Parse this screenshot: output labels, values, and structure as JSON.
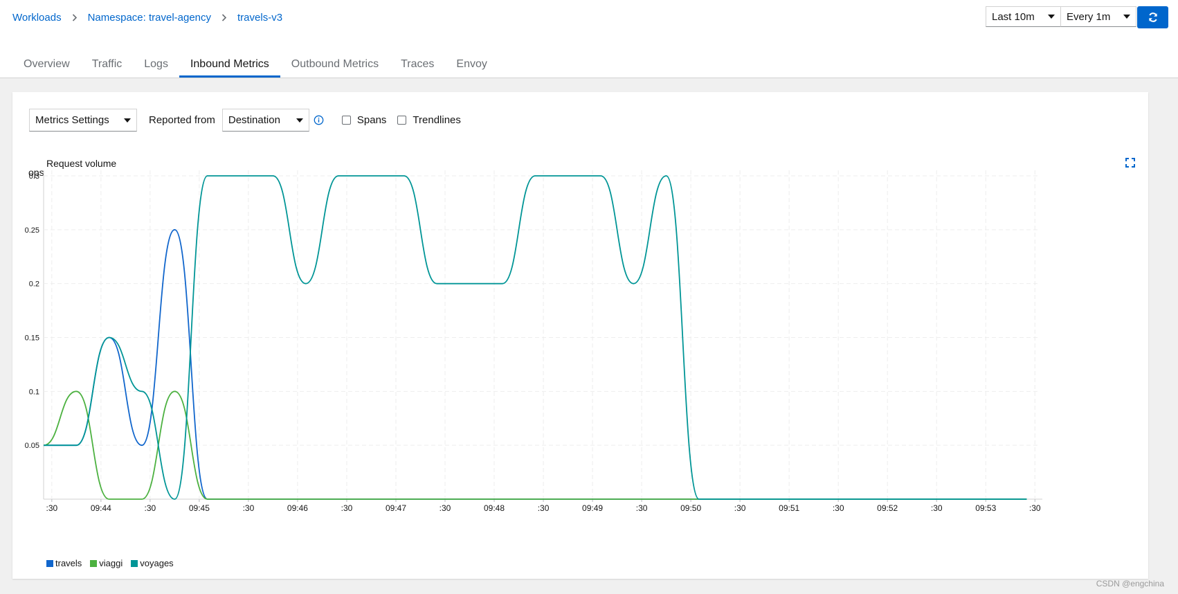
{
  "breadcrumb": {
    "items": [
      "Workloads",
      "Namespace: travel-agency",
      "travels-v3"
    ]
  },
  "controls": {
    "time_range": "Last 10m",
    "refresh_interval": "Every 1m",
    "refresh_icon": "sync-icon"
  },
  "tabs": [
    {
      "label": "Overview"
    },
    {
      "label": "Traffic"
    },
    {
      "label": "Logs"
    },
    {
      "label": "Inbound Metrics",
      "active": true
    },
    {
      "label": "Outbound Metrics"
    },
    {
      "label": "Traces"
    },
    {
      "label": "Envoy"
    }
  ],
  "toolbar": {
    "metrics_settings": "Metrics Settings",
    "reported_from_label": "Reported from",
    "reported_from_value": "Destination",
    "spans_label": "Spans",
    "trendlines_label": "Trendlines",
    "spans_checked": false,
    "trendlines_checked": false
  },
  "colors": {
    "accent": "#0066cc",
    "travels": "#1166cc",
    "viaggi": "#4cb140",
    "voyages": "#009596",
    "grid": "#ededed"
  },
  "chart_data": {
    "type": "line",
    "title": "Request volume",
    "ylabel": "ops",
    "ylim": [
      0,
      0.3
    ],
    "y_ticks": [
      0.05,
      0.1,
      0.15,
      0.2,
      0.25,
      0.3
    ],
    "y_tick_labels": [
      "0.05",
      "0.1",
      "0.15",
      "0.2",
      "0.25",
      "0.3"
    ],
    "x_tick_labels": [
      ":30",
      "09:44",
      ":30",
      "09:45",
      ":30",
      "09:46",
      ":30",
      "09:47",
      ":30",
      "09:48",
      ":30",
      "09:49",
      ":30",
      "09:50",
      ":30",
      "09:51",
      ":30",
      "09:52",
      ":30",
      "09:53",
      ":30"
    ],
    "x_ticks": [
      "09:43:30",
      "09:44:00",
      "09:44:30",
      "09:45:00",
      "09:45:30",
      "09:46:00",
      "09:46:30",
      "09:47:00",
      "09:47:30",
      "09:48:00",
      "09:48:30",
      "09:49:00",
      "09:49:30",
      "09:50:00",
      "09:50:30",
      "09:51:00",
      "09:51:30",
      "09:52:00",
      "09:52:30",
      "09:53:00",
      "09:53:30"
    ],
    "x_range": [
      "09:43:25",
      "09:53:32"
    ],
    "legend_position": "bottom-left",
    "grid": true,
    "series": [
      {
        "name": "travels",
        "x": [
          "09:43:25",
          "09:43:45",
          "09:44:05",
          "09:44:25",
          "09:44:45",
          "09:45:05",
          "09:45:25",
          "09:45:45",
          "09:46:05",
          "09:46:25",
          "09:46:45",
          "09:47:05",
          "09:47:25",
          "09:47:45",
          "09:48:05",
          "09:48:25",
          "09:48:45",
          "09:49:05",
          "09:49:25",
          "09:49:45",
          "09:50:05",
          "09:50:25",
          "09:50:45",
          "09:51:05",
          "09:51:25",
          "09:51:45",
          "09:52:05",
          "09:52:25",
          "09:52:45",
          "09:53:05",
          "09:53:25"
        ],
        "values": [
          0.05,
          0.05,
          0.15,
          0.05,
          0.25,
          0,
          0,
          0,
          0,
          0,
          0,
          0,
          0,
          0,
          0,
          0,
          0,
          0,
          0,
          0,
          0,
          0,
          0,
          0,
          0,
          0,
          0,
          0,
          0,
          0,
          0
        ]
      },
      {
        "name": "viaggi",
        "x": [
          "09:43:25",
          "09:43:45",
          "09:44:05",
          "09:44:25",
          "09:44:45",
          "09:45:05",
          "09:45:25",
          "09:45:45",
          "09:46:05",
          "09:46:25",
          "09:46:45",
          "09:47:05",
          "09:47:25",
          "09:47:45",
          "09:48:05",
          "09:48:25",
          "09:48:45",
          "09:49:05",
          "09:49:25",
          "09:49:45",
          "09:50:05",
          "09:50:25",
          "09:50:45",
          "09:51:05",
          "09:51:25",
          "09:51:45",
          "09:52:05",
          "09:52:25",
          "09:52:45",
          "09:53:05",
          "09:53:25"
        ],
        "values": [
          0.05,
          0.1,
          0,
          0,
          0.1,
          0,
          0,
          0,
          0,
          0,
          0,
          0,
          0,
          0,
          0,
          0,
          0,
          0,
          0,
          0,
          0,
          0,
          0,
          0,
          0,
          0,
          0,
          0,
          0,
          0,
          0
        ]
      },
      {
        "name": "voyages",
        "x": [
          "09:43:25",
          "09:43:45",
          "09:44:05",
          "09:44:25",
          "09:44:45",
          "09:45:05",
          "09:45:25",
          "09:45:45",
          "09:46:05",
          "09:46:25",
          "09:46:45",
          "09:47:05",
          "09:47:25",
          "09:47:45",
          "09:48:05",
          "09:48:25",
          "09:48:45",
          "09:49:05",
          "09:49:25",
          "09:49:45",
          "09:50:05",
          "09:50:25",
          "09:50:45",
          "09:51:05",
          "09:51:25",
          "09:51:45",
          "09:52:05",
          "09:52:25",
          "09:52:45",
          "09:53:05",
          "09:53:25"
        ],
        "values": [
          0.05,
          0.05,
          0.15,
          0.1,
          0,
          0.3,
          0.3,
          0.3,
          0.2,
          0.3,
          0.3,
          0.3,
          0.2,
          0.2,
          0.2,
          0.3,
          0.3,
          0.3,
          0.2,
          0.3,
          0,
          0,
          0,
          0,
          0,
          0,
          0,
          0,
          0,
          0,
          0
        ]
      }
    ]
  },
  "watermark": "CSDN @engchina"
}
